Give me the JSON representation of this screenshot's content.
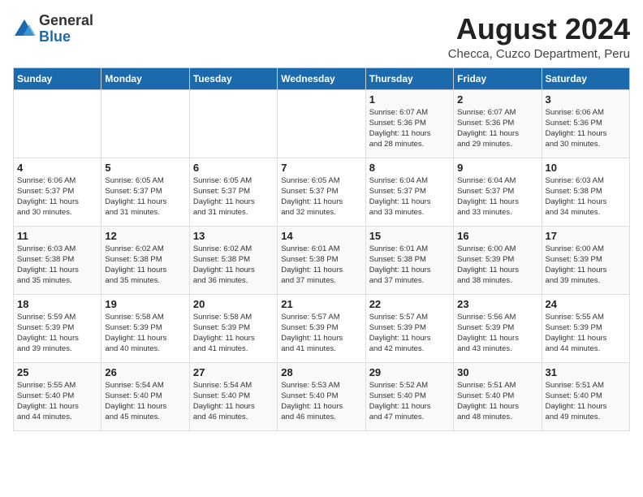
{
  "logo": {
    "general": "General",
    "blue": "Blue"
  },
  "title": "August 2024",
  "location": "Checca, Cuzco Department, Peru",
  "days_of_week": [
    "Sunday",
    "Monday",
    "Tuesday",
    "Wednesday",
    "Thursday",
    "Friday",
    "Saturday"
  ],
  "weeks": [
    [
      {
        "day": "",
        "info": ""
      },
      {
        "day": "",
        "info": ""
      },
      {
        "day": "",
        "info": ""
      },
      {
        "day": "",
        "info": ""
      },
      {
        "day": "1",
        "info": "Sunrise: 6:07 AM\nSunset: 5:36 PM\nDaylight: 11 hours\nand 28 minutes."
      },
      {
        "day": "2",
        "info": "Sunrise: 6:07 AM\nSunset: 5:36 PM\nDaylight: 11 hours\nand 29 minutes."
      },
      {
        "day": "3",
        "info": "Sunrise: 6:06 AM\nSunset: 5:36 PM\nDaylight: 11 hours\nand 30 minutes."
      }
    ],
    [
      {
        "day": "4",
        "info": "Sunrise: 6:06 AM\nSunset: 5:37 PM\nDaylight: 11 hours\nand 30 minutes."
      },
      {
        "day": "5",
        "info": "Sunrise: 6:05 AM\nSunset: 5:37 PM\nDaylight: 11 hours\nand 31 minutes."
      },
      {
        "day": "6",
        "info": "Sunrise: 6:05 AM\nSunset: 5:37 PM\nDaylight: 11 hours\nand 31 minutes."
      },
      {
        "day": "7",
        "info": "Sunrise: 6:05 AM\nSunset: 5:37 PM\nDaylight: 11 hours\nand 32 minutes."
      },
      {
        "day": "8",
        "info": "Sunrise: 6:04 AM\nSunset: 5:37 PM\nDaylight: 11 hours\nand 33 minutes."
      },
      {
        "day": "9",
        "info": "Sunrise: 6:04 AM\nSunset: 5:37 PM\nDaylight: 11 hours\nand 33 minutes."
      },
      {
        "day": "10",
        "info": "Sunrise: 6:03 AM\nSunset: 5:38 PM\nDaylight: 11 hours\nand 34 minutes."
      }
    ],
    [
      {
        "day": "11",
        "info": "Sunrise: 6:03 AM\nSunset: 5:38 PM\nDaylight: 11 hours\nand 35 minutes."
      },
      {
        "day": "12",
        "info": "Sunrise: 6:02 AM\nSunset: 5:38 PM\nDaylight: 11 hours\nand 35 minutes."
      },
      {
        "day": "13",
        "info": "Sunrise: 6:02 AM\nSunset: 5:38 PM\nDaylight: 11 hours\nand 36 minutes."
      },
      {
        "day": "14",
        "info": "Sunrise: 6:01 AM\nSunset: 5:38 PM\nDaylight: 11 hours\nand 37 minutes."
      },
      {
        "day": "15",
        "info": "Sunrise: 6:01 AM\nSunset: 5:38 PM\nDaylight: 11 hours\nand 37 minutes."
      },
      {
        "day": "16",
        "info": "Sunrise: 6:00 AM\nSunset: 5:39 PM\nDaylight: 11 hours\nand 38 minutes."
      },
      {
        "day": "17",
        "info": "Sunrise: 6:00 AM\nSunset: 5:39 PM\nDaylight: 11 hours\nand 39 minutes."
      }
    ],
    [
      {
        "day": "18",
        "info": "Sunrise: 5:59 AM\nSunset: 5:39 PM\nDaylight: 11 hours\nand 39 minutes."
      },
      {
        "day": "19",
        "info": "Sunrise: 5:58 AM\nSunset: 5:39 PM\nDaylight: 11 hours\nand 40 minutes."
      },
      {
        "day": "20",
        "info": "Sunrise: 5:58 AM\nSunset: 5:39 PM\nDaylight: 11 hours\nand 41 minutes."
      },
      {
        "day": "21",
        "info": "Sunrise: 5:57 AM\nSunset: 5:39 PM\nDaylight: 11 hours\nand 41 minutes."
      },
      {
        "day": "22",
        "info": "Sunrise: 5:57 AM\nSunset: 5:39 PM\nDaylight: 11 hours\nand 42 minutes."
      },
      {
        "day": "23",
        "info": "Sunrise: 5:56 AM\nSunset: 5:39 PM\nDaylight: 11 hours\nand 43 minutes."
      },
      {
        "day": "24",
        "info": "Sunrise: 5:55 AM\nSunset: 5:39 PM\nDaylight: 11 hours\nand 44 minutes."
      }
    ],
    [
      {
        "day": "25",
        "info": "Sunrise: 5:55 AM\nSunset: 5:40 PM\nDaylight: 11 hours\nand 44 minutes."
      },
      {
        "day": "26",
        "info": "Sunrise: 5:54 AM\nSunset: 5:40 PM\nDaylight: 11 hours\nand 45 minutes."
      },
      {
        "day": "27",
        "info": "Sunrise: 5:54 AM\nSunset: 5:40 PM\nDaylight: 11 hours\nand 46 minutes."
      },
      {
        "day": "28",
        "info": "Sunrise: 5:53 AM\nSunset: 5:40 PM\nDaylight: 11 hours\nand 46 minutes."
      },
      {
        "day": "29",
        "info": "Sunrise: 5:52 AM\nSunset: 5:40 PM\nDaylight: 11 hours\nand 47 minutes."
      },
      {
        "day": "30",
        "info": "Sunrise: 5:51 AM\nSunset: 5:40 PM\nDaylight: 11 hours\nand 48 minutes."
      },
      {
        "day": "31",
        "info": "Sunrise: 5:51 AM\nSunset: 5:40 PM\nDaylight: 11 hours\nand 49 minutes."
      }
    ]
  ]
}
